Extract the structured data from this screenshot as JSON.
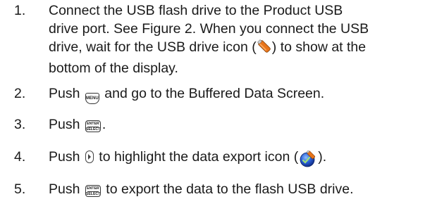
{
  "steps": [
    {
      "number": "1.",
      "lines": [
        "Connect the USB flash drive to the Product USB",
        "drive port. See Figure 2. When you connect the USB",
        [
          "drive, wait for the USB drive icon (",
          ") to show at the"
        ],
        "bottom of the display."
      ],
      "icon": "usb-drive-icon"
    },
    {
      "number": "2.",
      "before": "Push",
      "key_label": "MENU",
      "after": "and go to the Buffered Data Screen.",
      "icon": "menu-key-icon"
    },
    {
      "number": "3.",
      "before": "Push",
      "key_top": "ENTER",
      "key_bottom": "SELECT",
      "after": ".",
      "icon": "enter-select-key-icon"
    },
    {
      "number": "4.",
      "before": "Push",
      "middle": "to highlight the data export icon (",
      "after": ").",
      "icons": [
        "right-arrow-key-icon",
        "data-export-icon"
      ]
    },
    {
      "number": "5.",
      "before": "Push",
      "key_top": "ENTER",
      "key_bottom": "SELECT",
      "after": "to export the data to the flash USB drive.",
      "icon": "enter-select-key-icon"
    }
  ],
  "colors": {
    "text": "#1a1a1a",
    "usb_icon": "#e8741a",
    "export_icon": "#2a5fd6"
  }
}
